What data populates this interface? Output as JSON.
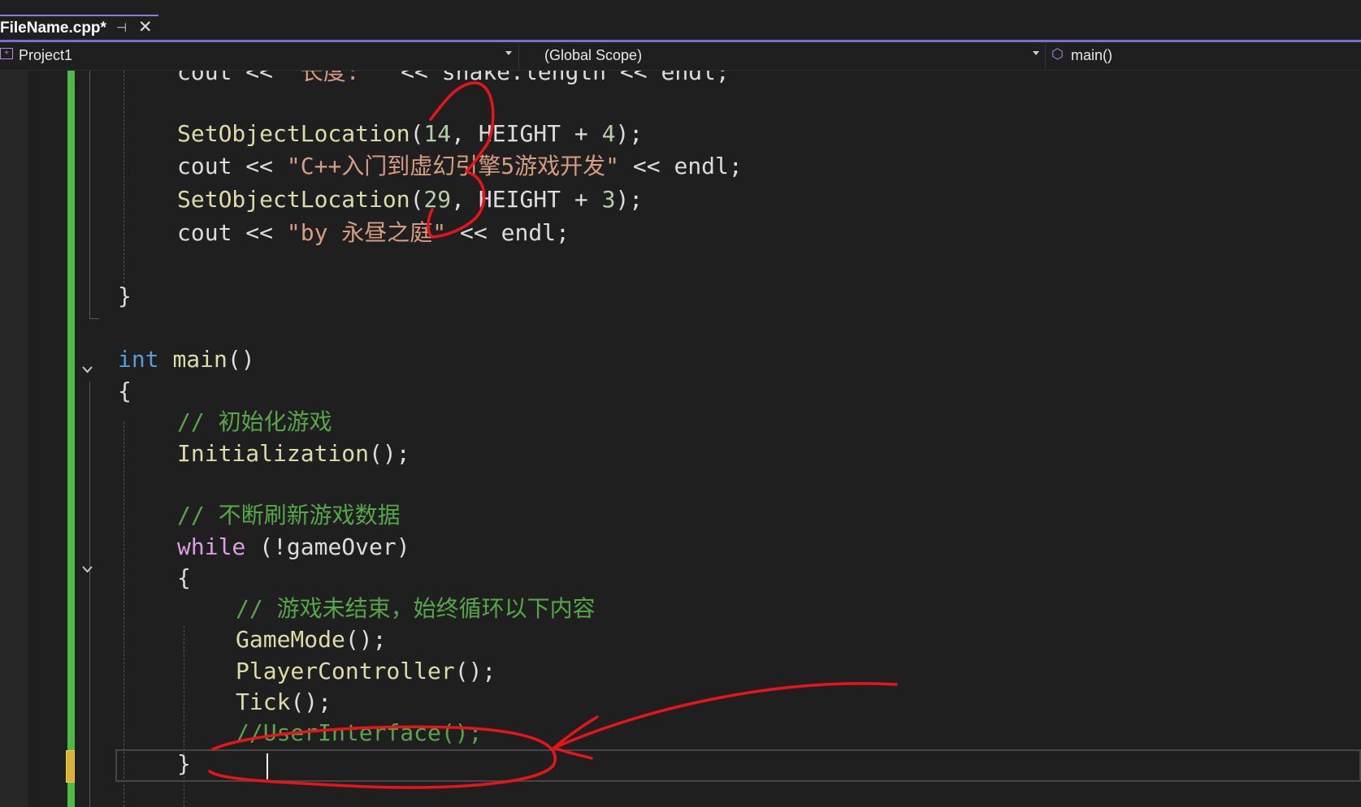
{
  "tab": {
    "title": "FileName.cpp*",
    "pin_icon": "pin-icon",
    "close_icon": "close-icon"
  },
  "navbar": {
    "project": "Project1",
    "scope": "(Global Scope)",
    "member": "main()",
    "icons": [
      "project-icon",
      "dropdown-icon",
      "cube-icon"
    ]
  },
  "code": {
    "l0": [
      "cout",
      " << ",
      "\"长度: \"",
      " << ",
      "snake.length",
      " << ",
      "endl;"
    ],
    "l1": [
      "SetObjectLocation",
      "(",
      "14",
      ", HEIGHT + ",
      "4",
      ");"
    ],
    "l2": [
      "cout",
      " << ",
      "\"C++入门到虚幻引擎5游戏开发\"",
      " << ",
      "endl;"
    ],
    "l3": [
      "SetObjectLocation",
      "(",
      "29",
      ", HEIGHT + ",
      "3",
      ");"
    ],
    "l4": [
      "cout",
      " << ",
      "\"by 永昼之庭\"",
      " << ",
      "endl;"
    ],
    "l5": "}",
    "l6": [
      "int",
      " ",
      "main",
      "()"
    ],
    "l7": "{",
    "l8": "// 初始化游戏",
    "l9": [
      "Initialization",
      "();"
    ],
    "l10": "// 不断刷新游戏数据",
    "l11": [
      "while",
      " (!gameOver)"
    ],
    "l12": "{",
    "l13": "// 游戏未结束，始终循环以下内容",
    "l14": [
      "GameMode",
      "();"
    ],
    "l15": [
      "PlayerController",
      "();"
    ],
    "l16": [
      "Tick",
      "();"
    ],
    "l17": "//UserInterface();",
    "l18": "}"
  },
  "colors": {
    "keyword": "#569cd6",
    "control": "#d8a0df",
    "function": "#dcdcaa",
    "number": "#b5cea8",
    "string": "#d69d85",
    "comment": "#57a64a",
    "change_bar": "#4fb947",
    "annotation": "#e8141b"
  }
}
